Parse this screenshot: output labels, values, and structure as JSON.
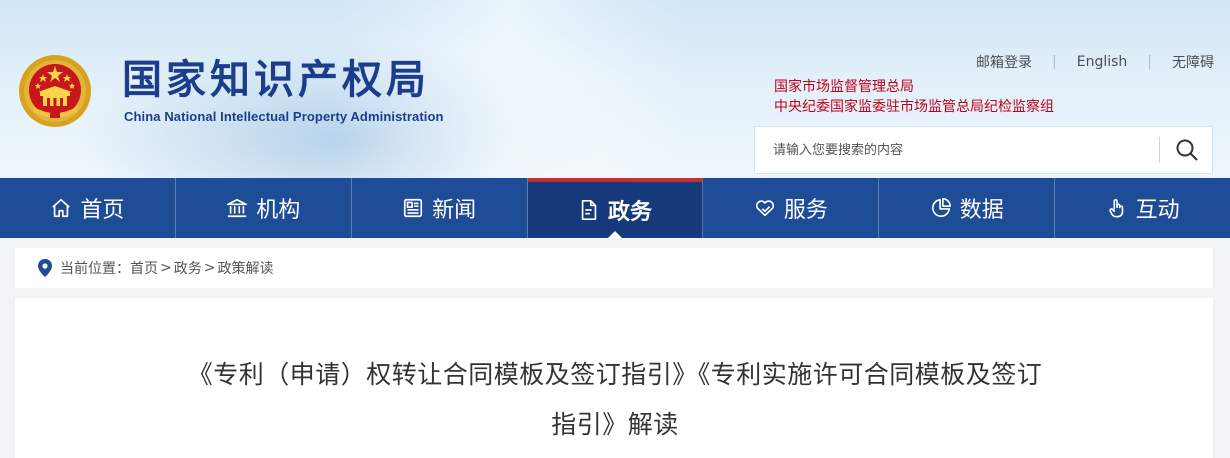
{
  "header": {
    "site_title": "国家知识产权局",
    "site_subtitle": "China National Intellectual Property Administration",
    "top_links": [
      "邮箱登录",
      "English",
      "无障碍"
    ],
    "affiliate_links": [
      "国家市场监督管理总局",
      "中央纪委国家监委驻市场监管总局纪检监察组"
    ],
    "search": {
      "placeholder": "请输入您要搜索的内容"
    },
    "colors": {
      "title": "#1c3d8c",
      "affiliate": "#c0001a"
    }
  },
  "nav": {
    "items": [
      {
        "label": "首页",
        "icon": "home-icon"
      },
      {
        "label": "机构",
        "icon": "building-icon"
      },
      {
        "label": "新闻",
        "icon": "newspaper-icon"
      },
      {
        "label": "政务",
        "icon": "document-icon",
        "active": true
      },
      {
        "label": "服务",
        "icon": "heart-hands-icon"
      },
      {
        "label": "数据",
        "icon": "pie-chart-icon"
      },
      {
        "label": "互动",
        "icon": "hand-pointer-icon"
      }
    ],
    "colors": {
      "background": "#1f4c96",
      "active": "#15397a",
      "active_top": "#c62f2f"
    }
  },
  "breadcrumb": {
    "prefix": "当前位置：",
    "items": [
      "首页",
      "政务",
      "政策解读"
    ],
    "separator": ">"
  },
  "article": {
    "title_line1": "《专利（申请）权转让合同模板及签订指引》《专利实施许可合同模板及签订",
    "title_line2": "指引》解读"
  }
}
